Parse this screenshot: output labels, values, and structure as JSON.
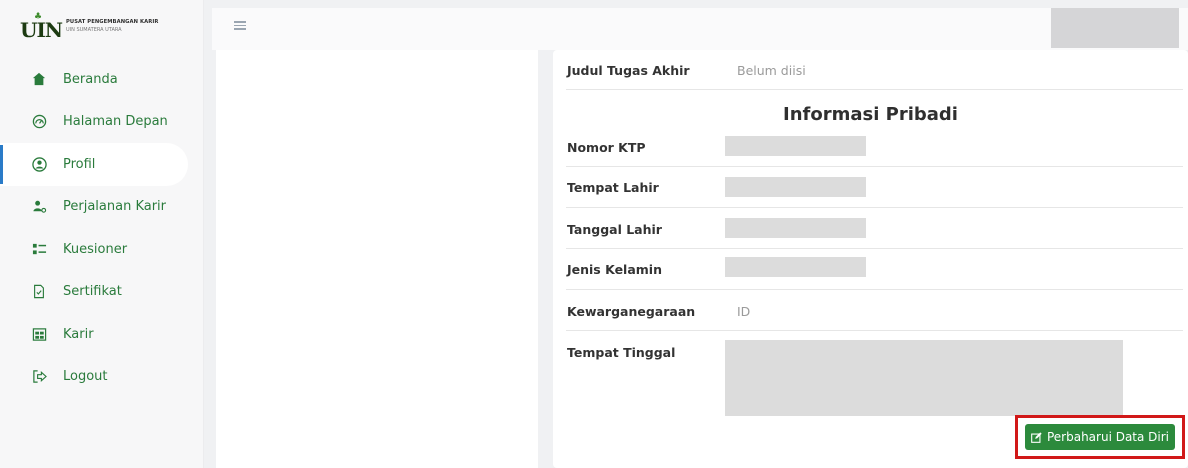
{
  "app": {
    "logo_title": "PUSAT PENGEMBANGAN KARIR",
    "logo_subtitle": "UIN SUMATERA UTARA",
    "logo_mark": "UIN"
  },
  "sidebar": {
    "items": [
      {
        "label": "Beranda",
        "icon": "home-icon"
      },
      {
        "label": "Halaman Depan",
        "icon": "dashboard-gauge-icon"
      },
      {
        "label": "Profil",
        "icon": "user-circle-icon",
        "active": true
      },
      {
        "label": "Perjalanan Karir",
        "icon": "user-career-icon"
      },
      {
        "label": "Kuesioner",
        "icon": "list-icon"
      },
      {
        "label": "Sertifikat",
        "icon": "certificate-file-icon"
      },
      {
        "label": "Karir",
        "icon": "briefcase-calendar-icon"
      },
      {
        "label": "Logout",
        "icon": "logout-icon"
      }
    ]
  },
  "profile": {
    "judul_label": "Judul Tugas Akhir",
    "judul_value": "Belum diisi",
    "section_title": "Informasi Pribadi",
    "fields": {
      "nomor_ktp": "Nomor KTP",
      "tempat_lahir": "Tempat Lahir",
      "tanggal_lahir": "Tanggal Lahir",
      "jenis_kelamin": "Jenis Kelamin",
      "kewarganegaraan": "Kewarganegaraan",
      "kewarganegaraan_value": "ID",
      "tempat_tinggal": "Tempat Tinggal"
    },
    "update_button": "Perbaharui Data Diri"
  },
  "colors": {
    "accent_green": "#2c8a3c",
    "nav_green": "#2a7b3c",
    "highlight_red": "#d11818",
    "active_indicator": "#2a7bc8"
  }
}
